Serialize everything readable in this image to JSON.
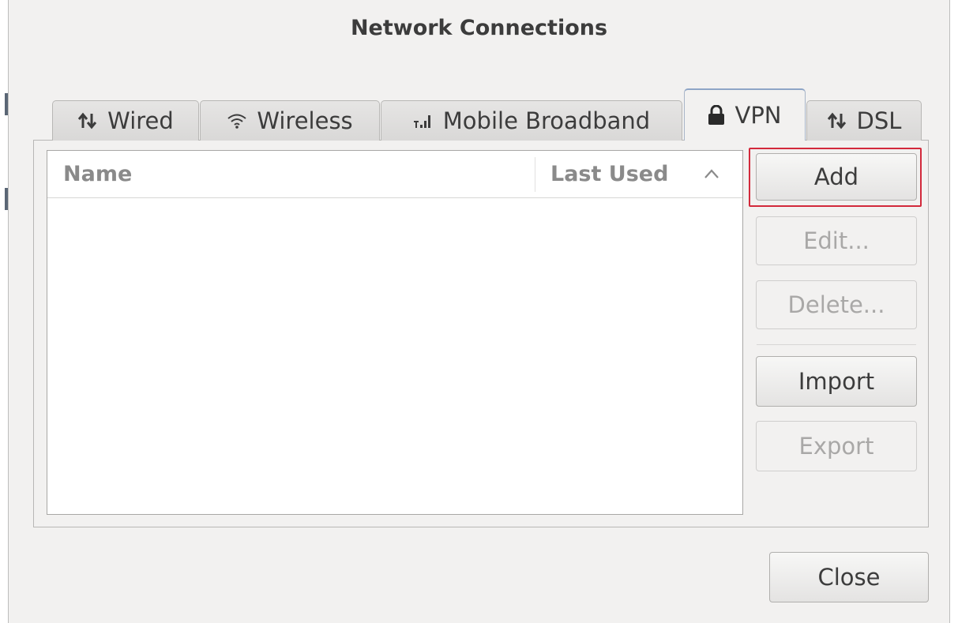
{
  "window": {
    "title": "Network Connections"
  },
  "tabs": [
    {
      "label": "Wired",
      "icon": "wired-connection-icon",
      "active": false
    },
    {
      "label": "Wireless",
      "icon": "wifi-icon",
      "active": false
    },
    {
      "label": "Mobile Broadband",
      "icon": "signal-bars-icon",
      "active": false
    },
    {
      "label": "VPN",
      "icon": "lock-icon",
      "active": true
    },
    {
      "label": "DSL",
      "icon": "dsl-connection-icon",
      "active": false
    }
  ],
  "list": {
    "columns": [
      "Name",
      "Last Used"
    ],
    "sort": "ascending",
    "rows": []
  },
  "buttons": {
    "add": "Add",
    "edit": "Edit...",
    "delete": "Delete...",
    "import": "Import",
    "export": "Export",
    "close": "Close"
  },
  "colors": {
    "highlight": "#d3293b",
    "active_tab_border": "#8ea5c6"
  }
}
